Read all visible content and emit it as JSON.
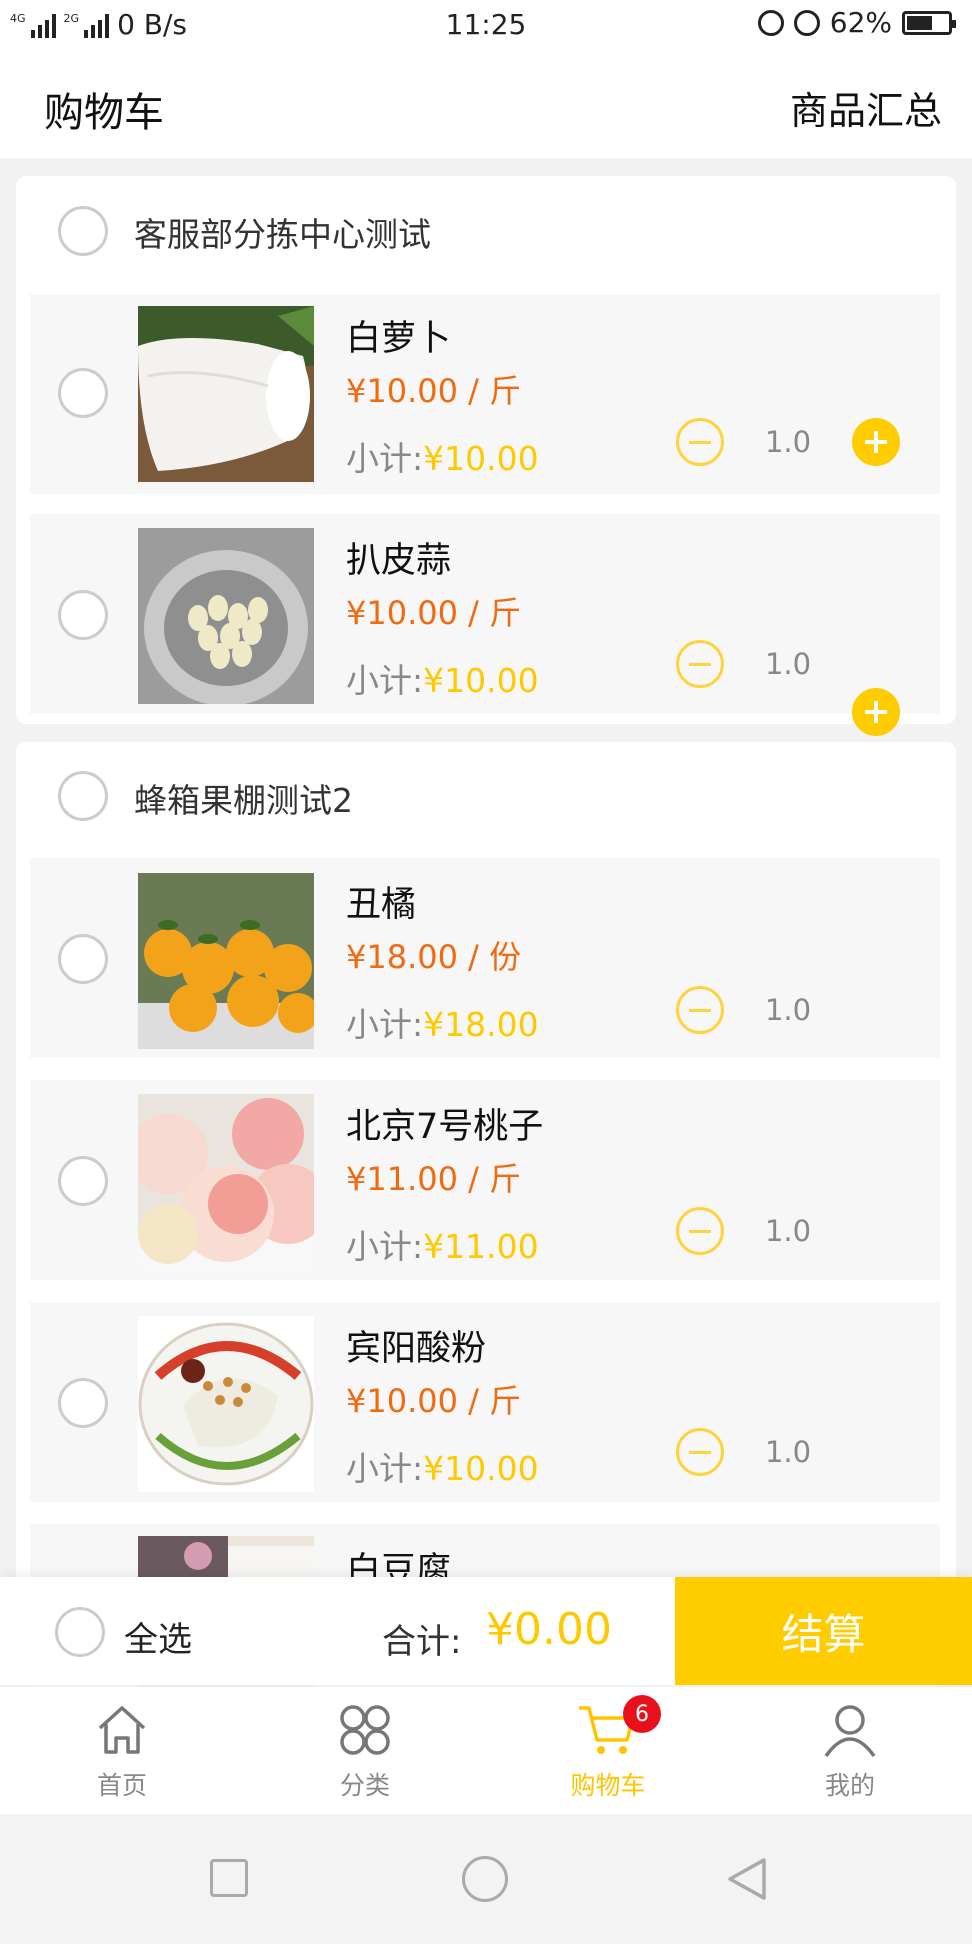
{
  "status_bar": {
    "network_1": "4G",
    "network_2": "2G",
    "speed": "0 B/s",
    "time": "11:25",
    "battery": "62%",
    "battery_level": 0.62
  },
  "header": {
    "title": "购物车",
    "summary_link": "商品汇总"
  },
  "stores": [
    {
      "name": "客服部分拣中心测试",
      "items": [
        {
          "name": "白萝卜",
          "price": "¥10.00 / 斤",
          "subtotal_label": "小计:",
          "subtotal": "¥10.00",
          "qty": "1.0"
        },
        {
          "name": "扒皮蒜",
          "price": "¥10.00 / 斤",
          "subtotal_label": "小计:",
          "subtotal": "¥10.00",
          "qty": "1.0"
        }
      ]
    },
    {
      "name": "蜂箱果棚测试2",
      "items": [
        {
          "name": "丑橘",
          "price": "¥18.00 / 份",
          "subtotal_label": "小计:",
          "subtotal": "¥18.00",
          "qty": "1.0"
        },
        {
          "name": "北京7号桃子",
          "price": "¥11.00 / 斤",
          "subtotal_label": "小计:",
          "subtotal": "¥11.00",
          "qty": "1.0"
        },
        {
          "name": "宾阳酸粉",
          "price": "¥10.00 / 斤",
          "subtotal_label": "小计:",
          "subtotal": "¥10.00",
          "qty": "1.0"
        },
        {
          "name": "白豆腐"
        }
      ]
    }
  ],
  "checkout": {
    "select_all": "全选",
    "total_label": "合计:",
    "total": "¥0.00",
    "pay": "结算"
  },
  "tabs": [
    {
      "label": "首页",
      "icon": "home-icon"
    },
    {
      "label": "分类",
      "icon": "category-icon"
    },
    {
      "label": "购物车",
      "icon": "cart-icon",
      "badge": "6",
      "active": true
    },
    {
      "label": "我的",
      "icon": "profile-icon"
    }
  ],
  "colors": {
    "accent": "#ffcc00",
    "price": "#f06a10",
    "active_tab": "#ffc400",
    "badge": "#e8101c"
  }
}
